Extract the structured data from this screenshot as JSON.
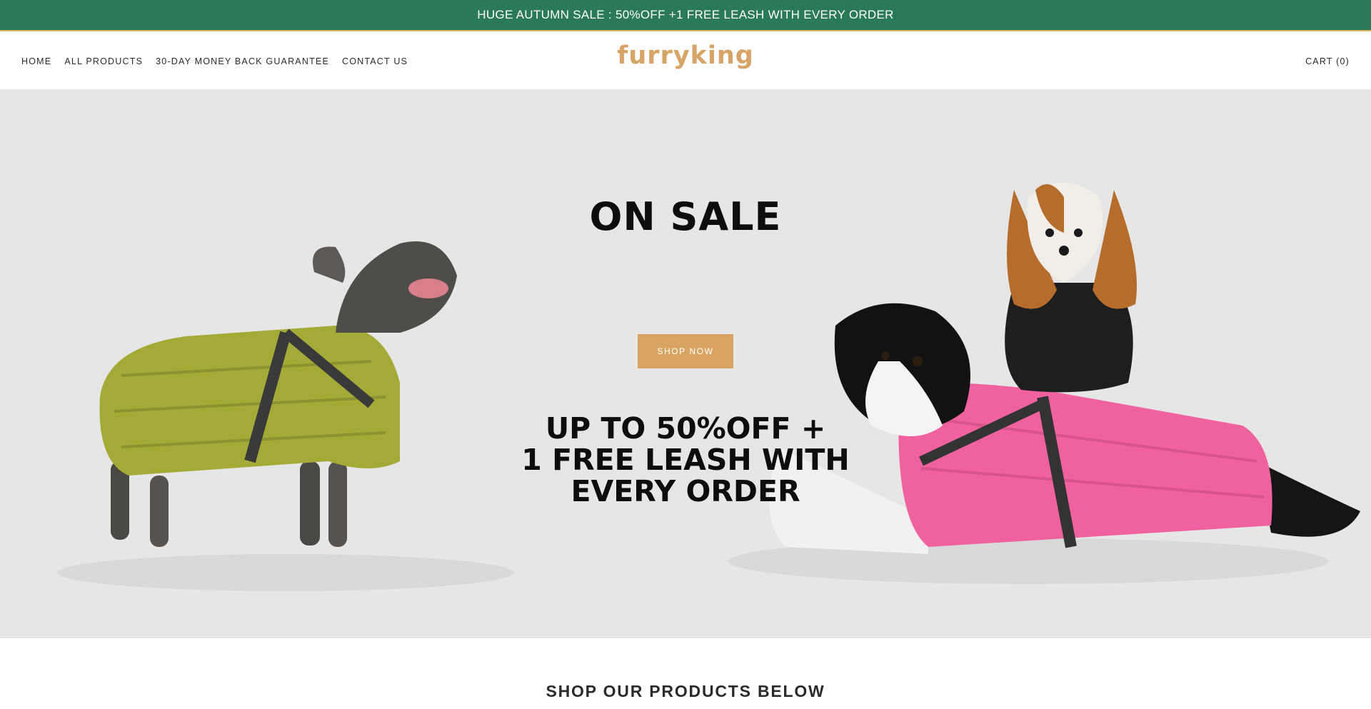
{
  "announcement": {
    "text": "HUGE AUTUMN SALE : 50%OFF +1 FREE LEASH WITH EVERY ORDER"
  },
  "header": {
    "nav": [
      {
        "label": "HOME"
      },
      {
        "label": "ALL PRODUCTS"
      },
      {
        "label": "30-DAY MONEY BACK GUARANTEE"
      },
      {
        "label": "CONTACT US"
      }
    ],
    "logo_text": "furryking",
    "cart_label": "CART (0)"
  },
  "hero": {
    "title": "ON SALE",
    "button_label": "SHOP NOW",
    "subtitle_lines": [
      "UP TO 50%OFF +",
      "1 FREE LEASH WITH",
      "EVERY ORDER"
    ]
  },
  "products_section": {
    "title": "SHOP OUR PRODUCTS BELOW"
  },
  "colors": {
    "announce_bg": "#2a7a55",
    "logo": "#d7a467",
    "button": "#d8a462",
    "hero_bg": "#e6e6e6"
  }
}
